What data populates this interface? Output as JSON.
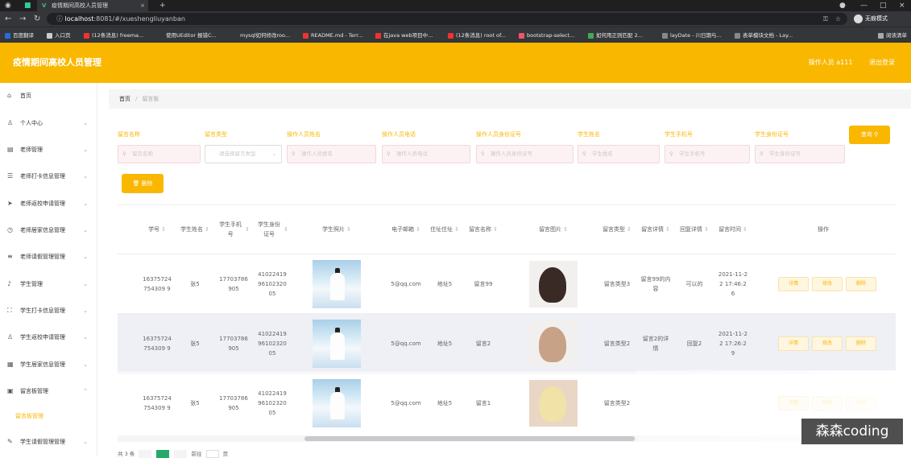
{
  "browser": {
    "tab_title": "疫情期间高校人员管理",
    "url_host": "localhost",
    "url_rest": ":8081/#/xueshengliuyanban",
    "profile": "无痕模式",
    "bookmarks": [
      "百度翻译",
      "入口页",
      "(12条消息) freema...",
      "使用UEditor 报错C...",
      "mysql如何修改roo...",
      "README.md - Terr...",
      "在java web项目中...",
      "(12条消息) root of...",
      "bootstrap-select...",
      "如何用正则匹配 2...",
      "layDate - 川日期与...",
      "表单模块文档 - Lay...",
      "阅读清单"
    ]
  },
  "header": {
    "title": "疫情期间高校人员管理",
    "user": "操作人员 a111",
    "logout": "退出登录"
  },
  "sidebar": {
    "items": [
      {
        "label": "首页",
        "icon": "home-icon"
      },
      {
        "label": "个人中心",
        "icon": "user-icon"
      },
      {
        "label": "老师管理",
        "icon": "teacher-icon"
      },
      {
        "label": "老师打卡信息管理",
        "icon": "list-icon"
      },
      {
        "label": "老师返校申请管理",
        "icon": "send-icon"
      },
      {
        "label": "老师居家信息管理",
        "icon": "clock-icon"
      },
      {
        "label": "老师请假管理管理",
        "icon": "menu-icon"
      },
      {
        "label": "学生管理",
        "icon": "mic-icon"
      },
      {
        "label": "学生打卡信息管理",
        "icon": "scan-icon"
      },
      {
        "label": "学生返校申请管理",
        "icon": "user-plus-icon"
      },
      {
        "label": "学生居家信息管理",
        "icon": "grid-icon"
      },
      {
        "label": "留言板管理",
        "icon": "board-icon"
      },
      {
        "label": "留言板管理",
        "icon": ""
      },
      {
        "label": "学生请假管理管理",
        "icon": "leave-icon"
      }
    ]
  },
  "breadcrumb": {
    "home": "首页",
    "sep": "/",
    "current": "留言板"
  },
  "filters": [
    {
      "label": "留言名称",
      "placeholder": "留言名称"
    },
    {
      "label": "留言类型",
      "placeholder": "请选择留言类型"
    },
    {
      "label": "操作人员姓名",
      "placeholder": "操作人员姓名"
    },
    {
      "label": "操作人员电话",
      "placeholder": "操作人员电话"
    },
    {
      "label": "操作人员身份证号",
      "placeholder": "操作人员身份证号"
    },
    {
      "label": "学生姓名",
      "placeholder": "学生姓名"
    },
    {
      "label": "学生手机号",
      "placeholder": "学生手机号"
    },
    {
      "label": "学生身份证号",
      "placeholder": "学生身份证号"
    }
  ],
  "buttons": {
    "query": "查询",
    "delete": "删除"
  },
  "table": {
    "headers": [
      "学号",
      "学生姓名",
      "学生手机号",
      "学生身份证号",
      "学生照片",
      "电子邮箱",
      "住址住址",
      "留言名称",
      "留言图片",
      "留言类型",
      "留言详情",
      "回复详情",
      "留言时间",
      "操作"
    ],
    "rows": [
      {
        "xh": "16375724754309 9",
        "name": "张5",
        "phone": "17703786905",
        "id": "410224199610232005",
        "email": "5@qq.com",
        "addr": "地址5",
        "msg": "留言99",
        "type": "留言类型3",
        "detail": "留言99的内容",
        "reply": "可以的",
        "time": "2021-11-22 17:46:26"
      },
      {
        "xh": "16375724754309 9",
        "name": "张5",
        "phone": "17703786905",
        "id": "410224199610232005",
        "email": "5@qq.com",
        "addr": "地址5",
        "msg": "留言2",
        "type": "留言类型2",
        "detail": "留言2的详情",
        "reply": "回复2",
        "time": "2021-11-22 17:26:29"
      },
      {
        "xh": "16375724754309 9",
        "name": "张5",
        "phone": "17703786905",
        "id": "410224199610232005",
        "email": "5@qq.com",
        "addr": "地址5",
        "msg": "留言1",
        "type": "留言类型2",
        "detail": "",
        "reply": "",
        "time": ""
      }
    ],
    "ops": [
      "详情",
      "修改",
      "删除"
    ]
  },
  "pager": {
    "total": "共 3 条",
    "page": "1",
    "goto": "前往",
    "unit": "页"
  },
  "watermark": "森森coding"
}
